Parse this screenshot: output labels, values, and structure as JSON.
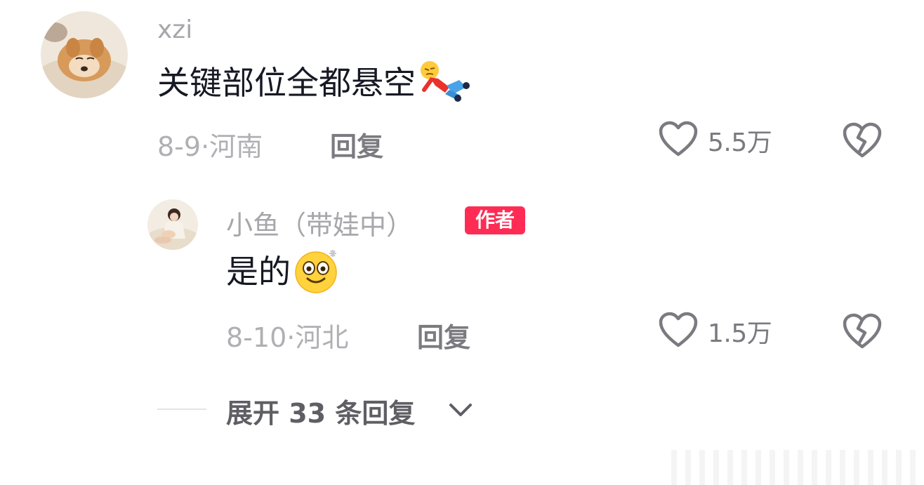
{
  "comment": {
    "username": "xzi",
    "text": "关键部位全都悬空",
    "date_location": "8-9·河南",
    "reply_label": "回复",
    "like_count": "5.5万",
    "emoji_icon": "lying-down-person-emoji"
  },
  "reply": {
    "username": "小鱼（带娃中）",
    "author_badge": "作者",
    "text": "是的",
    "date_location": "8-10·河北",
    "reply_label": "回复",
    "like_count": "1.5万",
    "emoji_icon": "dizzy-smile-emoji"
  },
  "expand": {
    "label": "展开 33 条回复"
  },
  "colors": {
    "author_badge": "#fe2c55",
    "primary_text": "#161823",
    "secondary_text": "#a7a7ab"
  }
}
